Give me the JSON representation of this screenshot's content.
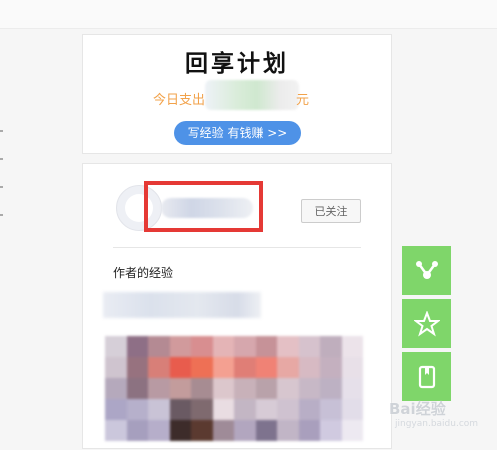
{
  "top_card": {
    "logo_text": "回享计划",
    "spend_prefix": "今日支出",
    "spend_suffix": "元",
    "write_button": "写经验 有钱赚 >>"
  },
  "author_card": {
    "follow_button": "已关注",
    "experience_title": "作者的经验"
  },
  "side_buttons": [
    {
      "icon": "share-icon"
    },
    {
      "icon": "star-icon"
    },
    {
      "icon": "bookmark-icon"
    }
  ],
  "watermark": {
    "text": "Bai经验",
    "sub": "jingyan.baidu.com"
  },
  "colors": {
    "accent_blue": "#4e92e7",
    "spend_orange": "#f2a24a",
    "side_green": "#7fd66a",
    "highlight_red": "#e53935"
  },
  "photo_pixels": [
    "#d6cfd8",
    "#8e6f86",
    "#b48a93",
    "#d19a9c",
    "#d88e90",
    "#e4b4b6",
    "#d6a7ad",
    "#c69298",
    "#e4c0c5",
    "#d6c2cd",
    "#bfaebd",
    "#ece3ea",
    "#cfc4cf",
    "#97727f",
    "#d87f78",
    "#e85c4d",
    "#ee7055",
    "#f4a091",
    "#e07e76",
    "#f08275",
    "#e7a8a4",
    "#d7bac3",
    "#c4b0bf",
    "#e8e0e8",
    "#b5a9bc",
    "#8c7281",
    "#b89aa3",
    "#c39c9c",
    "#a78c92",
    "#dcc7cc",
    "#c8b1b9",
    "#b9a2aa",
    "#d7c6cf",
    "#c7b8c6",
    "#bdb1c3",
    "#e6e0ea",
    "#aca6c6",
    "#b6b0cb",
    "#c9c3d6",
    "#6a5a63",
    "#7f6a6f",
    "#e9dde2",
    "#c3b6c4",
    "#d7cbd6",
    "#cfc2d0",
    "#b8aec6",
    "#c7c0d6",
    "#e2dde9",
    "#cbc7dc",
    "#a69fbe",
    "#b6aeca",
    "#3d2c2a",
    "#5b3a30",
    "#9f8b98",
    "#b2a6bf",
    "#7e738e",
    "#c1b5c6",
    "#a99fbd",
    "#d0cae0",
    "#ede9f1"
  ]
}
